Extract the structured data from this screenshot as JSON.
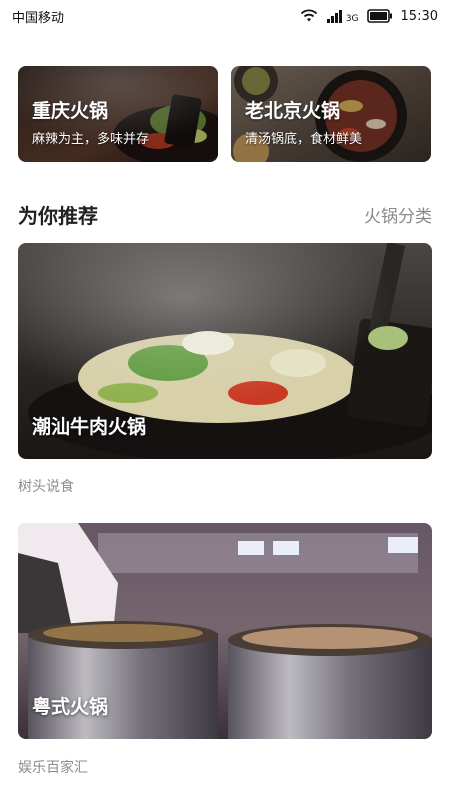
{
  "status_bar": {
    "carrier": "中国移动",
    "network": "3G",
    "time": "15:30"
  },
  "top_categories": [
    {
      "title": "重庆火锅",
      "subtitle": "麻辣为主，多味并存"
    },
    {
      "title": "老北京火锅",
      "subtitle": "清汤锅底，食材鲜美"
    }
  ],
  "recommend": {
    "title": "为你推荐",
    "link_label": "火锅分类"
  },
  "feed": [
    {
      "title": "潮汕牛肉火锅",
      "source": "树头说食"
    },
    {
      "title": "粤式火锅",
      "source": "娱乐百家汇"
    }
  ]
}
